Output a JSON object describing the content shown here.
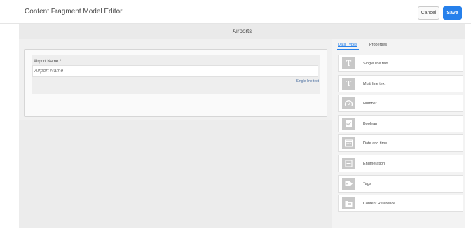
{
  "header": {
    "title": "Content Fragment Model Editor",
    "cancel_label": "Cancel",
    "save_label": "Save"
  },
  "model": {
    "title": "Airports"
  },
  "form": {
    "fields": [
      {
        "label": "Airport Name *",
        "placeholder": "Airport Name",
        "type_label": "Single line text"
      }
    ]
  },
  "panel": {
    "tabs": [
      {
        "label": "Data Types",
        "active": true
      },
      {
        "label": "Properties",
        "active": false
      }
    ],
    "data_types": [
      {
        "label": "Single line text",
        "icon": "text-t-icon"
      },
      {
        "label": "Multi line text",
        "icon": "text-t-icon"
      },
      {
        "label": "Number",
        "icon": "gauge-icon"
      },
      {
        "label": "Boolean",
        "icon": "checkbox-icon"
      },
      {
        "label": "Date and time",
        "icon": "calendar-icon"
      },
      {
        "label": "Enumeration",
        "icon": "list-icon"
      },
      {
        "label": "Tags",
        "icon": "tag-icon"
      },
      {
        "label": "Content Reference",
        "icon": "folder-reference-icon"
      }
    ]
  },
  "colors": {
    "accent": "#2680eb",
    "icon_bg": "#c8c8c8"
  }
}
